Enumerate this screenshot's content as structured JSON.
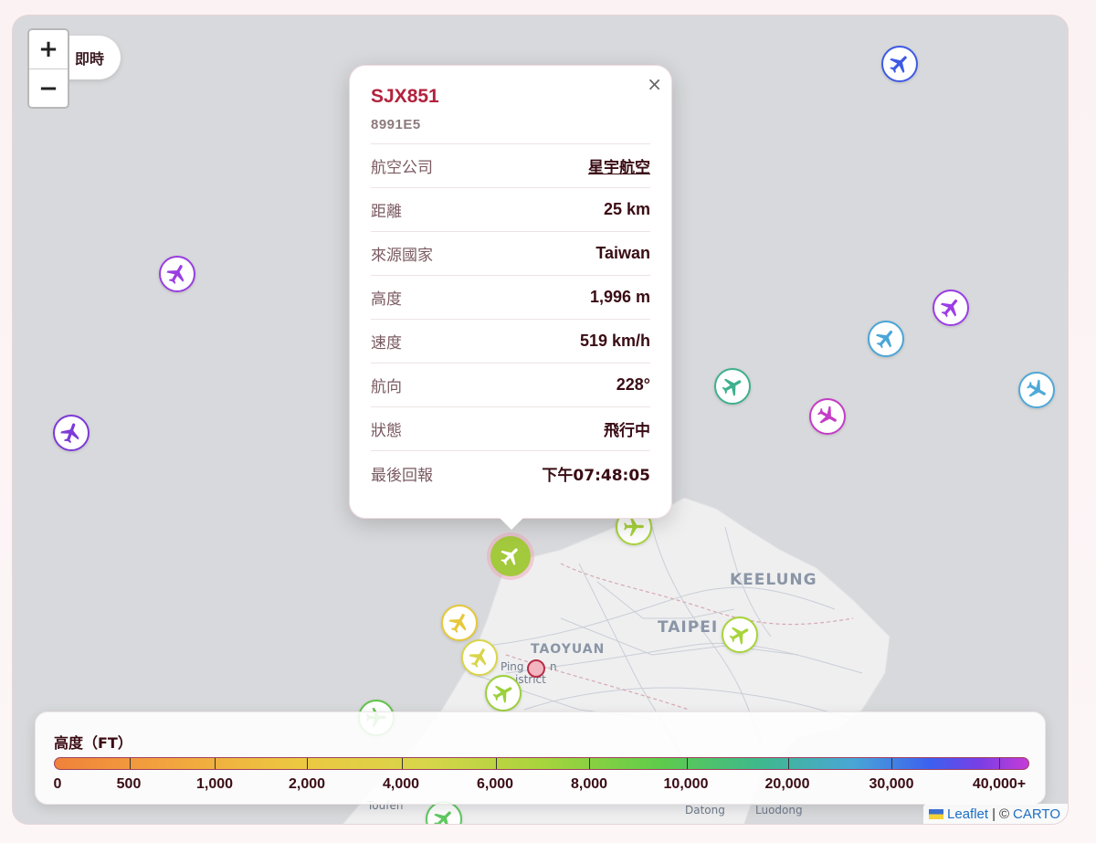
{
  "controls": {
    "zoom_in": "+",
    "zoom_out": "−",
    "live_label": "即時"
  },
  "map": {
    "labels": {
      "keelung": "KEELUNG",
      "taipei": "TAIPEI",
      "taoyuan": "TAOYUAN",
      "pingzhen_1": "Ping",
      "pingzhen_2": "n",
      "district": "istrict",
      "toufen": "Toufen",
      "datong": "Datong",
      "luodong": "Luodong"
    },
    "aircraft_colors": [
      "#3d5ae6",
      "#9a3ee0",
      "#7c3ad8",
      "#9b3ee6",
      "#4ba6d8",
      "#3fb08e",
      "#c43cc6",
      "#4fa9d8",
      "#a3c93c",
      "#e6c83a",
      "#d9d54a",
      "#a8d43c",
      "#9cd03c",
      "#62c44a",
      "#5fc860"
    ]
  },
  "popup": {
    "close": "×",
    "callsign": "SJX851",
    "icao": "8991E5",
    "rows": [
      {
        "key": "航空公司",
        "value": "星宇航空"
      },
      {
        "key": "距離",
        "value": "25 km"
      },
      {
        "key": "來源國家",
        "value": "Taiwan"
      },
      {
        "key": "高度",
        "value": "1,996 m"
      },
      {
        "key": "速度",
        "value": "519 km/h"
      },
      {
        "key": "航向",
        "value": "228°"
      },
      {
        "key": "狀態",
        "value": "飛行中"
      },
      {
        "key": "最後回報",
        "value": "下午07:48:05"
      }
    ]
  },
  "legend": {
    "title": "高度（FT）",
    "labels": [
      "0",
      "500",
      "1,000",
      "2,000",
      "4,000",
      "6,000",
      "8,000",
      "10,000",
      "20,000",
      "30,000",
      "40,000+"
    ]
  },
  "attribution": {
    "leaflet": "Leaflet",
    "separator": "|",
    "copyright": "©",
    "carto": "CARTO"
  }
}
